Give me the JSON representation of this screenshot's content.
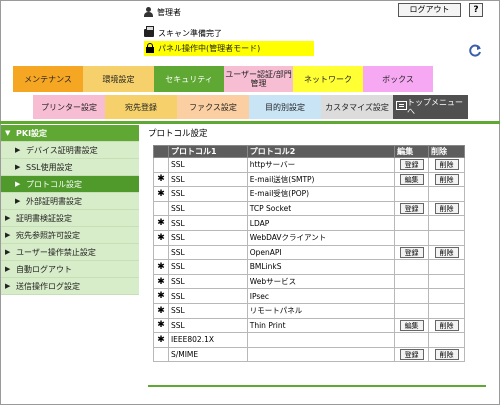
{
  "header": {
    "user_name": "管理者",
    "logout_label": "ログアウト",
    "help_label": "?",
    "status_text": "スキャン準備完了",
    "panel_text": "パネル操作中(管理者モード)"
  },
  "main_tabs": [
    {
      "label": "メンテナンス"
    },
    {
      "label": "環境設定"
    },
    {
      "label": "セキュリティ"
    },
    {
      "label": "ユーザー認証/部門管理"
    },
    {
      "label": "ネットワーク"
    },
    {
      "label": "ボックス"
    }
  ],
  "sub_tabs": [
    {
      "label": "プリンター設定"
    },
    {
      "label": "宛先登録"
    },
    {
      "label": "ファクス設定"
    },
    {
      "label": "目的別設定"
    },
    {
      "label": "カスタマイズ設定"
    },
    {
      "label": "トップメニューへ"
    }
  ],
  "sidebar": {
    "items": [
      {
        "label": "PKI設定"
      },
      {
        "label": "デバイス証明書設定"
      },
      {
        "label": "SSL使用設定"
      },
      {
        "label": "プロトコル設定"
      },
      {
        "label": "外部証明書設定"
      },
      {
        "label": "証明書検証設定"
      },
      {
        "label": "宛先参照許可設定"
      },
      {
        "label": "ユーザー操作禁止設定"
      },
      {
        "label": "自動ログアウト"
      },
      {
        "label": "送信操作ログ設定"
      }
    ]
  },
  "content": {
    "title": "プロトコル設定",
    "columns": [
      "プロトコル1",
      "プロトコル2",
      "編集",
      "削除"
    ],
    "edit_label": "登録",
    "edit_label_alt": "編集",
    "delete_label": "削除",
    "rows": [
      {
        "mark": "",
        "p1": "SSL",
        "p2": "httpサーバー",
        "btn": "登録",
        "del": "削除"
      },
      {
        "mark": "✱",
        "p1": "SSL",
        "p2": "E-mail送信(SMTP)",
        "btn": "編集",
        "del": "削除"
      },
      {
        "mark": "✱",
        "p1": "SSL",
        "p2": "E-mail受信(POP)",
        "btn": "",
        "del": ""
      },
      {
        "mark": "",
        "p1": "SSL",
        "p2": "TCP Socket",
        "btn": "登録",
        "del": "削除"
      },
      {
        "mark": "✱",
        "p1": "SSL",
        "p2": "LDAP",
        "btn": "",
        "del": ""
      },
      {
        "mark": "✱",
        "p1": "SSL",
        "p2": "WebDAVクライアント",
        "btn": "",
        "del": ""
      },
      {
        "mark": "",
        "p1": "SSL",
        "p2": "OpenAPI",
        "btn": "登録",
        "del": "削除"
      },
      {
        "mark": "✱",
        "p1": "SSL",
        "p2": "BMLinkS",
        "btn": "",
        "del": ""
      },
      {
        "mark": "✱",
        "p1": "SSL",
        "p2": "Webサービス",
        "btn": "",
        "del": ""
      },
      {
        "mark": "✱",
        "p1": "SSL",
        "p2": "IPsec",
        "btn": "",
        "del": ""
      },
      {
        "mark": "✱",
        "p1": "SSL",
        "p2": "リモートパネル",
        "btn": "",
        "del": ""
      },
      {
        "mark": "✱",
        "p1": "SSL",
        "p2": "Thin Print",
        "btn": "編集",
        "del": "削除"
      },
      {
        "mark": "✱",
        "p1": "IEEE802.1X",
        "p2": "",
        "btn": "",
        "del": ""
      },
      {
        "mark": "",
        "p1": "S/MIME",
        "p2": "",
        "btn": "登録",
        "del": "削除"
      }
    ]
  },
  "colors": {
    "security_green": "#5fa834",
    "sidebar_light": "#d7ecc8",
    "panel_yellow": "#ffff00"
  }
}
